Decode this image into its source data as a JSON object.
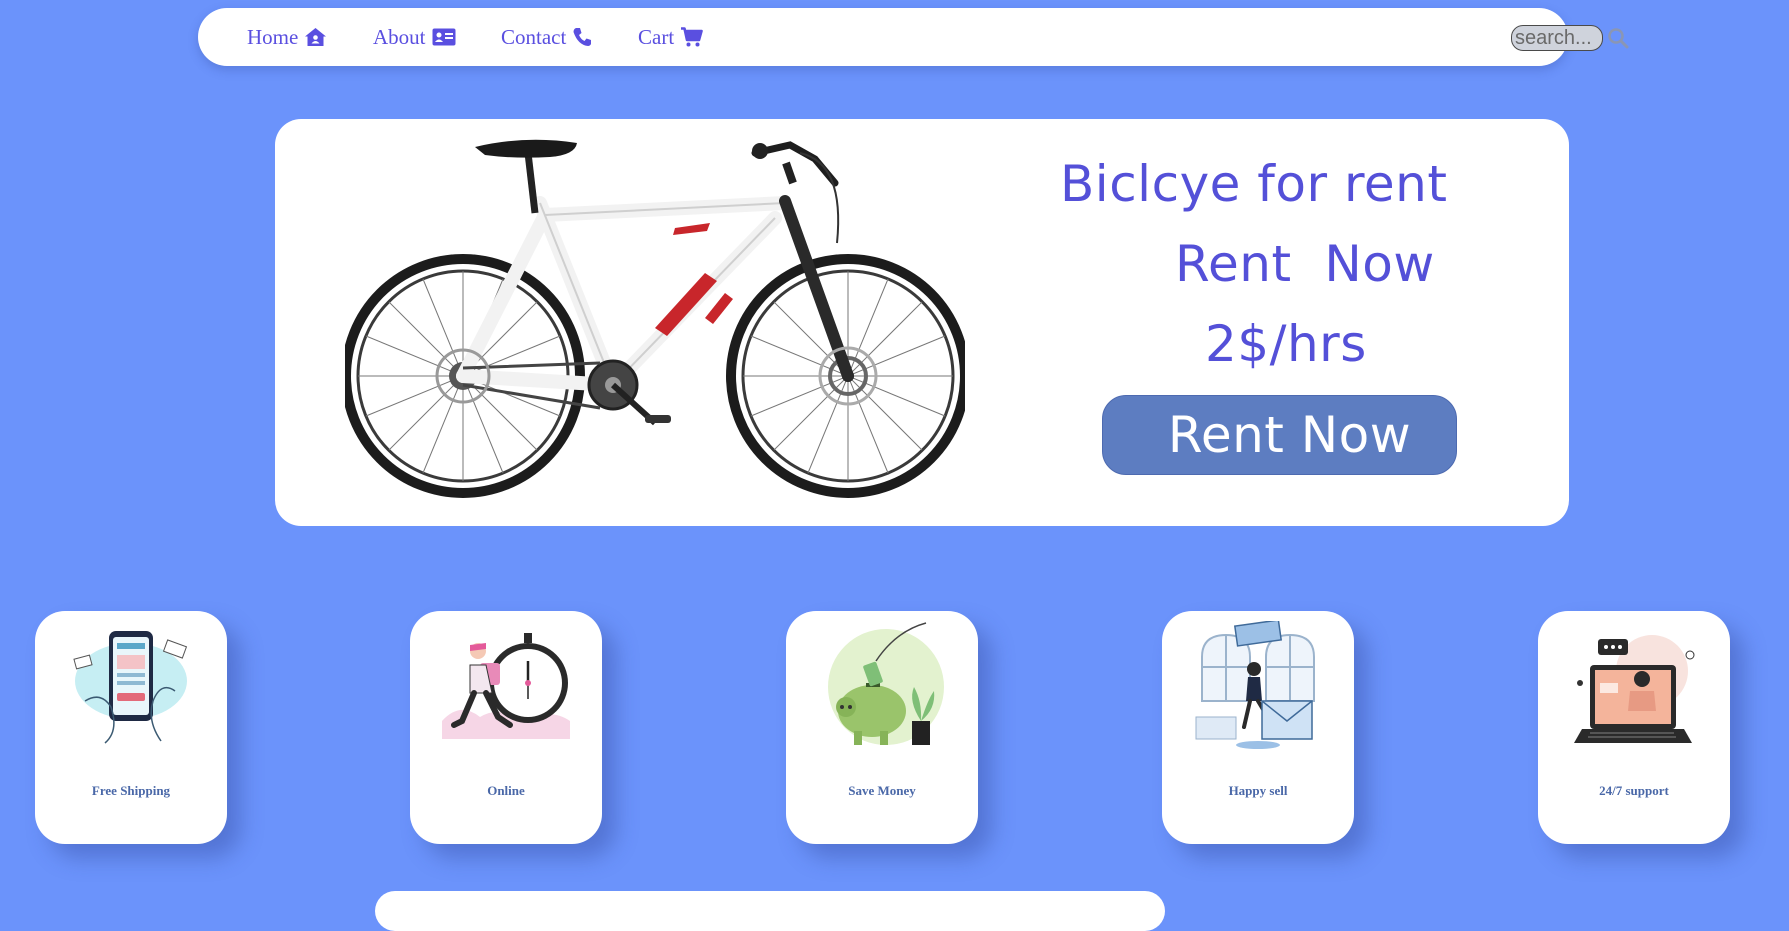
{
  "nav": {
    "items": [
      {
        "label": "Home",
        "icon": "home-icon"
      },
      {
        "label": "About",
        "icon": "id-card-icon"
      },
      {
        "label": "Contact",
        "icon": "phone-icon"
      },
      {
        "label": "Cart",
        "icon": "cart-icon"
      }
    ],
    "search_placeholder": "search...",
    "accent": "#5a4fe0"
  },
  "hero": {
    "title": "Biclcye for rent",
    "subtitle": "Rent  Now",
    "price": "2$/hrs",
    "button_label": "Rent Now",
    "image": "bicycle-image"
  },
  "features": [
    {
      "label": "Free Shipping",
      "image": "mobile-payment-illustration"
    },
    {
      "label": "Online",
      "image": "delivery-stopwatch-illustration"
    },
    {
      "label": "Save Money",
      "image": "piggy-bank-illustration"
    },
    {
      "label": "Happy sell",
      "image": "happy-shopper-illustration"
    },
    {
      "label": "24/7 support",
      "image": "support-laptop-illustration"
    }
  ],
  "colors": {
    "background": "#6b93fb",
    "panel": "#ffffff",
    "heading": "#5450d8",
    "button": "#5d7dc1",
    "card_label": "#4a68a8"
  }
}
